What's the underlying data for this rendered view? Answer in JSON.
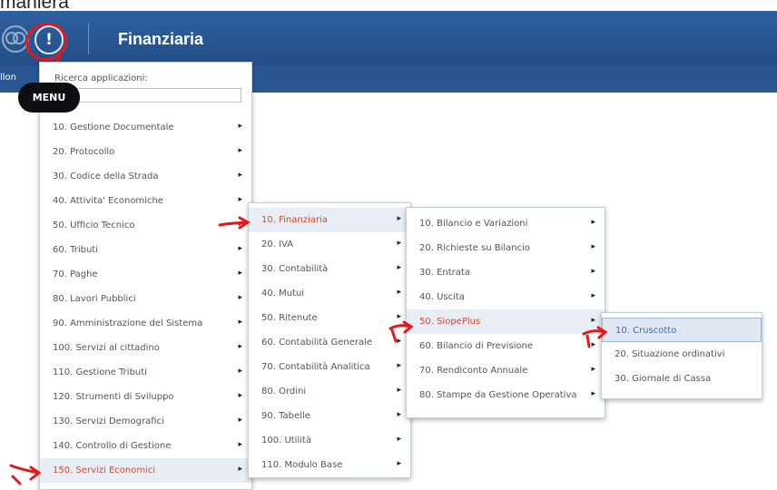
{
  "caption_fragment": "maniera",
  "header": {
    "title": "Finanziaria",
    "info_glyph": "!",
    "subbar_cut_label": "llon"
  },
  "tooltip": {
    "label": "MENU"
  },
  "search": {
    "label": "Ricerca applicazioni:",
    "value": "",
    "placeholder": ""
  },
  "menus": {
    "main": [
      {
        "label": "10. Gestione Documentale"
      },
      {
        "label": "20. Protocollo"
      },
      {
        "label": "30. Codice della Strada"
      },
      {
        "label": "40. Attivita' Economiche"
      },
      {
        "label": "50. Ufficio Tecnico"
      },
      {
        "label": "60. Tributi"
      },
      {
        "label": "70. Paghe"
      },
      {
        "label": "80. Lavori Pubblici"
      },
      {
        "label": "90. Amministrazione del Sistema"
      },
      {
        "label": "100. Servizi al cittadino"
      },
      {
        "label": "110. Gestione Tributi"
      },
      {
        "label": "120. Strumenti di Sviluppo"
      },
      {
        "label": "130. Servizi Demografici"
      },
      {
        "label": "140. Controllo di Gestione"
      },
      {
        "label": "150. Servizi Economici",
        "active": true
      }
    ],
    "finanziaria": [
      {
        "label": "10. Finanziaria",
        "active": true
      },
      {
        "label": "20. IVA"
      },
      {
        "label": "30. Contabilità"
      },
      {
        "label": "40. Mutui"
      },
      {
        "label": "50. Ritenute"
      },
      {
        "label": "60. Contabilità Generale"
      },
      {
        "label": "70. Contabilità Analitica"
      },
      {
        "label": "80. Ordini"
      },
      {
        "label": "90. Tabelle"
      },
      {
        "label": "100. Utilità"
      },
      {
        "label": "110. Modulo Base"
      }
    ],
    "siope_parent": [
      {
        "label": "10. Bilancio e Variazioni"
      },
      {
        "label": "20. Richieste su Bilancio"
      },
      {
        "label": "30. Entrata"
      },
      {
        "label": "40. Uscita"
      },
      {
        "label": "50. SiopePlus",
        "active": true
      },
      {
        "label": "60. Bilancio di Previsione"
      },
      {
        "label": "70. Rendiconto Annuale"
      },
      {
        "label": "80. Stampe da Gestione Operativa"
      }
    ],
    "siopeplus": [
      {
        "label": "10. Cruscotto",
        "selected": true
      },
      {
        "label": "20. Situazione ordinativi"
      },
      {
        "label": "30. Giornale di Cassa"
      }
    ]
  },
  "arrow_glyph": "▸",
  "colors": {
    "header_blue": "#2d5f9f",
    "annotation_red": "#e11b1b",
    "active_text": "#d34a2e"
  }
}
